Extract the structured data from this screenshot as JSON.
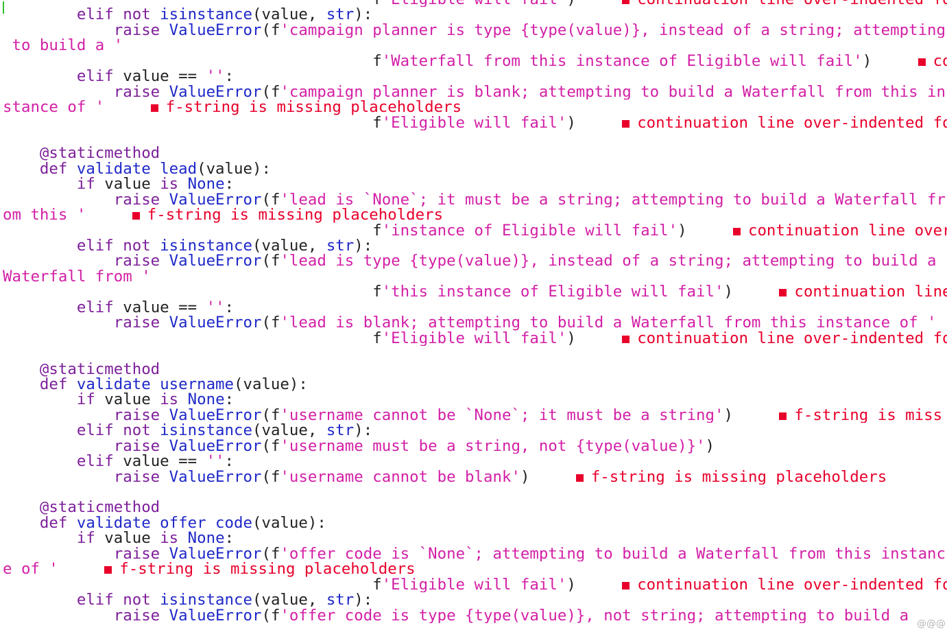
{
  "colors": {
    "keyword": "#7d1f9a",
    "builtin": "#1e28c8",
    "string": "#d31fa6",
    "default": "#222222",
    "lint": "#e8002b",
    "cursor": "#2fbf2f"
  },
  "lines": [
    {
      "segs": [
        {
          "t": "                                        ",
          "c": "default"
        },
        {
          "t": "f",
          "c": "default"
        },
        {
          "t": "'Eligible will fail'",
          "c": "string"
        },
        {
          "t": ")",
          "c": "default"
        }
      ],
      "lint": "continuation line over-indented for visual"
    },
    {
      "segs": [
        {
          "t": "        ",
          "c": "default"
        },
        {
          "t": "elif not ",
          "c": "keyword"
        },
        {
          "t": "isinstance",
          "c": "builtin"
        },
        {
          "t": "(value, ",
          "c": "default"
        },
        {
          "t": "str",
          "c": "builtin"
        },
        {
          "t": "):",
          "c": "default"
        }
      ]
    },
    {
      "segs": [
        {
          "t": "            ",
          "c": "default"
        },
        {
          "t": "raise ",
          "c": "keyword"
        },
        {
          "t": "ValueError",
          "c": "builtin"
        },
        {
          "t": "(f",
          "c": "default"
        },
        {
          "t": "'campaign_planner is type {type(value)}, instead of a string; attempting",
          "c": "string"
        }
      ]
    },
    {
      "segs": [
        {
          "t": " to build a '",
          "c": "string"
        }
      ]
    },
    {
      "segs": [
        {
          "t": "                                        ",
          "c": "default"
        },
        {
          "t": "f",
          "c": "default"
        },
        {
          "t": "'Waterfall from this instance of Eligible will fail'",
          "c": "string"
        },
        {
          "t": ")",
          "c": "default"
        }
      ],
      "lint": "continuati"
    },
    {
      "segs": [
        {
          "t": "        ",
          "c": "default"
        },
        {
          "t": "elif ",
          "c": "keyword"
        },
        {
          "t": "value == ",
          "c": "default"
        },
        {
          "t": "''",
          "c": "string"
        },
        {
          "t": ":",
          "c": "default"
        }
      ]
    },
    {
      "segs": [
        {
          "t": "            ",
          "c": "default"
        },
        {
          "t": "raise ",
          "c": "keyword"
        },
        {
          "t": "ValueError",
          "c": "builtin"
        },
        {
          "t": "(f",
          "c": "default"
        },
        {
          "t": "'campaign_planner is blank; attempting to build a Waterfall from this in",
          "c": "string"
        }
      ]
    },
    {
      "segs": [
        {
          "t": "stance of '",
          "c": "string"
        }
      ],
      "lint": "f-string is missing placeholders"
    },
    {
      "segs": [
        {
          "t": "                                        ",
          "c": "default"
        },
        {
          "t": "f",
          "c": "default"
        },
        {
          "t": "'Eligible will fail'",
          "c": "string"
        },
        {
          "t": ")",
          "c": "default"
        }
      ],
      "lint": "continuation line over-indented for visual"
    },
    {
      "segs": []
    },
    {
      "segs": [
        {
          "t": "    ",
          "c": "default"
        },
        {
          "t": "@staticmethod",
          "c": "keyword"
        }
      ]
    },
    {
      "segs": [
        {
          "t": "    ",
          "c": "default"
        },
        {
          "t": "def ",
          "c": "keyword"
        },
        {
          "t": "validate_lead",
          "c": "builtin"
        },
        {
          "t": "(value):",
          "c": "default"
        }
      ]
    },
    {
      "segs": [
        {
          "t": "        ",
          "c": "default"
        },
        {
          "t": "if ",
          "c": "keyword"
        },
        {
          "t": "value ",
          "c": "default"
        },
        {
          "t": "is ",
          "c": "keyword"
        },
        {
          "t": "None",
          "c": "builtin"
        },
        {
          "t": ":",
          "c": "default"
        }
      ]
    },
    {
      "segs": [
        {
          "t": "            ",
          "c": "default"
        },
        {
          "t": "raise ",
          "c": "keyword"
        },
        {
          "t": "ValueError",
          "c": "builtin"
        },
        {
          "t": "(f",
          "c": "default"
        },
        {
          "t": "'lead is `None`; it must be a string; attempting to build a Waterfall fr",
          "c": "string"
        }
      ]
    },
    {
      "segs": [
        {
          "t": "om this '",
          "c": "string"
        }
      ],
      "lint": "f-string is missing placeholders"
    },
    {
      "segs": [
        {
          "t": "                                        ",
          "c": "default"
        },
        {
          "t": "f",
          "c": "default"
        },
        {
          "t": "'instance of Eligible will fail'",
          "c": "string"
        },
        {
          "t": ")",
          "c": "default"
        }
      ],
      "lint": "continuation line over-indente"
    },
    {
      "segs": [
        {
          "t": "        ",
          "c": "default"
        },
        {
          "t": "elif not ",
          "c": "keyword"
        },
        {
          "t": "isinstance",
          "c": "builtin"
        },
        {
          "t": "(value, ",
          "c": "default"
        },
        {
          "t": "str",
          "c": "builtin"
        },
        {
          "t": "):",
          "c": "default"
        }
      ]
    },
    {
      "segs": [
        {
          "t": "            ",
          "c": "default"
        },
        {
          "t": "raise ",
          "c": "keyword"
        },
        {
          "t": "ValueError",
          "c": "builtin"
        },
        {
          "t": "(f",
          "c": "default"
        },
        {
          "t": "'lead is type {type(value)}, instead of a string; attempting to build a",
          "c": "string"
        }
      ]
    },
    {
      "segs": [
        {
          "t": "Waterfall from '",
          "c": "string"
        }
      ]
    },
    {
      "segs": [
        {
          "t": "                                        ",
          "c": "default"
        },
        {
          "t": "f",
          "c": "default"
        },
        {
          "t": "'this instance of Eligible will fail'",
          "c": "string"
        },
        {
          "t": ")",
          "c": "default"
        }
      ],
      "lint": "continuation line over-in"
    },
    {
      "segs": [
        {
          "t": "        ",
          "c": "default"
        },
        {
          "t": "elif ",
          "c": "keyword"
        },
        {
          "t": "value == ",
          "c": "default"
        },
        {
          "t": "''",
          "c": "string"
        },
        {
          "t": ":",
          "c": "default"
        }
      ]
    },
    {
      "segs": [
        {
          "t": "            ",
          "c": "default"
        },
        {
          "t": "raise ",
          "c": "keyword"
        },
        {
          "t": "ValueError",
          "c": "builtin"
        },
        {
          "t": "(f",
          "c": "default"
        },
        {
          "t": "'lead is blank; attempting to build a Waterfall from this instance of '",
          "c": "string"
        }
      ]
    },
    {
      "segs": [
        {
          "t": "                                        ",
          "c": "default"
        },
        {
          "t": "f",
          "c": "default"
        },
        {
          "t": "'Eligible will fail'",
          "c": "string"
        },
        {
          "t": ")",
          "c": "default"
        }
      ],
      "lint": "continuation line over-indented for visual"
    },
    {
      "segs": []
    },
    {
      "segs": [
        {
          "t": "    ",
          "c": "default"
        },
        {
          "t": "@staticmethod",
          "c": "keyword"
        }
      ]
    },
    {
      "segs": [
        {
          "t": "    ",
          "c": "default"
        },
        {
          "t": "def ",
          "c": "keyword"
        },
        {
          "t": "validate_username",
          "c": "builtin"
        },
        {
          "t": "(value):",
          "c": "default"
        }
      ]
    },
    {
      "segs": [
        {
          "t": "        ",
          "c": "default"
        },
        {
          "t": "if ",
          "c": "keyword"
        },
        {
          "t": "value ",
          "c": "default"
        },
        {
          "t": "is ",
          "c": "keyword"
        },
        {
          "t": "None",
          "c": "builtin"
        },
        {
          "t": ":",
          "c": "default"
        }
      ]
    },
    {
      "segs": [
        {
          "t": "            ",
          "c": "default"
        },
        {
          "t": "raise ",
          "c": "keyword"
        },
        {
          "t": "ValueError",
          "c": "builtin"
        },
        {
          "t": "(f",
          "c": "default"
        },
        {
          "t": "'username cannot be `None`; it must be a string'",
          "c": "string"
        },
        {
          "t": ")",
          "c": "default"
        }
      ],
      "lint": "f-string is miss"
    },
    {
      "segs": [
        {
          "t": "        ",
          "c": "default"
        },
        {
          "t": "elif not ",
          "c": "keyword"
        },
        {
          "t": "isinstance",
          "c": "builtin"
        },
        {
          "t": "(value, ",
          "c": "default"
        },
        {
          "t": "str",
          "c": "builtin"
        },
        {
          "t": "):",
          "c": "default"
        }
      ]
    },
    {
      "segs": [
        {
          "t": "            ",
          "c": "default"
        },
        {
          "t": "raise ",
          "c": "keyword"
        },
        {
          "t": "ValueError",
          "c": "builtin"
        },
        {
          "t": "(f",
          "c": "default"
        },
        {
          "t": "'username must be a string, not {type(value)}'",
          "c": "string"
        },
        {
          "t": ")",
          "c": "default"
        }
      ]
    },
    {
      "segs": [
        {
          "t": "        ",
          "c": "default"
        },
        {
          "t": "elif ",
          "c": "keyword"
        },
        {
          "t": "value == ",
          "c": "default"
        },
        {
          "t": "''",
          "c": "string"
        },
        {
          "t": ":",
          "c": "default"
        }
      ]
    },
    {
      "segs": [
        {
          "t": "            ",
          "c": "default"
        },
        {
          "t": "raise ",
          "c": "keyword"
        },
        {
          "t": "ValueError",
          "c": "builtin"
        },
        {
          "t": "(f",
          "c": "default"
        },
        {
          "t": "'username cannot be blank'",
          "c": "string"
        },
        {
          "t": ")",
          "c": "default"
        }
      ],
      "lint": "f-string is missing placeholders"
    },
    {
      "segs": []
    },
    {
      "segs": [
        {
          "t": "    ",
          "c": "default"
        },
        {
          "t": "@staticmethod",
          "c": "keyword"
        }
      ]
    },
    {
      "segs": [
        {
          "t": "    ",
          "c": "default"
        },
        {
          "t": "def ",
          "c": "keyword"
        },
        {
          "t": "validate_offer_code",
          "c": "builtin"
        },
        {
          "t": "(value):",
          "c": "default"
        }
      ]
    },
    {
      "segs": [
        {
          "t": "        ",
          "c": "default"
        },
        {
          "t": "if ",
          "c": "keyword"
        },
        {
          "t": "value ",
          "c": "default"
        },
        {
          "t": "is ",
          "c": "keyword"
        },
        {
          "t": "None",
          "c": "builtin"
        },
        {
          "t": ":",
          "c": "default"
        }
      ]
    },
    {
      "segs": [
        {
          "t": "            ",
          "c": "default"
        },
        {
          "t": "raise ",
          "c": "keyword"
        },
        {
          "t": "ValueError",
          "c": "builtin"
        },
        {
          "t": "(f",
          "c": "default"
        },
        {
          "t": "'offer_code is `None`; attempting to build a Waterfall from this instanc",
          "c": "string"
        }
      ]
    },
    {
      "segs": [
        {
          "t": "e of '",
          "c": "string"
        }
      ],
      "lint": "f-string is missing placeholders"
    },
    {
      "segs": [
        {
          "t": "                                        ",
          "c": "default"
        },
        {
          "t": "f",
          "c": "default"
        },
        {
          "t": "'Eligible will fail'",
          "c": "string"
        },
        {
          "t": ")",
          "c": "default"
        }
      ],
      "lint": "continuation line over-indented for visual"
    },
    {
      "segs": [
        {
          "t": "        ",
          "c": "default"
        },
        {
          "t": "elif not ",
          "c": "keyword"
        },
        {
          "t": "isinstance",
          "c": "builtin"
        },
        {
          "t": "(value, ",
          "c": "default"
        },
        {
          "t": "str",
          "c": "builtin"
        },
        {
          "t": "):",
          "c": "default"
        }
      ]
    },
    {
      "segs": [
        {
          "t": "            ",
          "c": "default"
        },
        {
          "t": "raise ",
          "c": "keyword"
        },
        {
          "t": "ValueError",
          "c": "builtin"
        },
        {
          "t": "(f",
          "c": "default"
        },
        {
          "t": "'offer_code is type {type(value)}, not string; attempting to build a",
          "c": "string"
        }
      ]
    }
  ],
  "corner_text": "@@@"
}
